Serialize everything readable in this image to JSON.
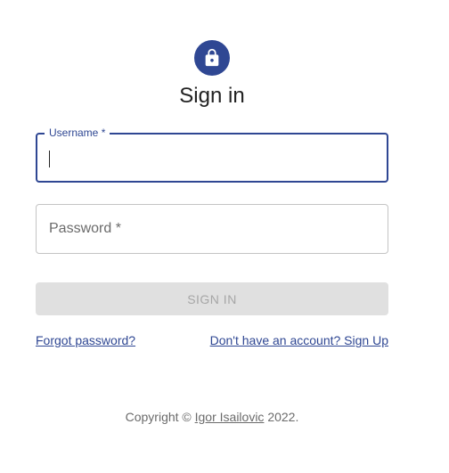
{
  "header": {
    "icon": "lock-icon",
    "title": "Sign in"
  },
  "form": {
    "username": {
      "label": "Username *",
      "value": ""
    },
    "password": {
      "label": "Password *",
      "value": ""
    },
    "submit_label": "SIGN IN",
    "submit_enabled": false
  },
  "links": {
    "forgot_password": "Forgot password?",
    "sign_up": "Don't have an account? Sign Up"
  },
  "footer": {
    "prefix": "Copyright © ",
    "author": "Igor Isailovic",
    "suffix": " 2022."
  },
  "colors": {
    "primary": "#2f4793",
    "disabled_bg": "#e0e0e0",
    "border": "#c4c4c4"
  }
}
